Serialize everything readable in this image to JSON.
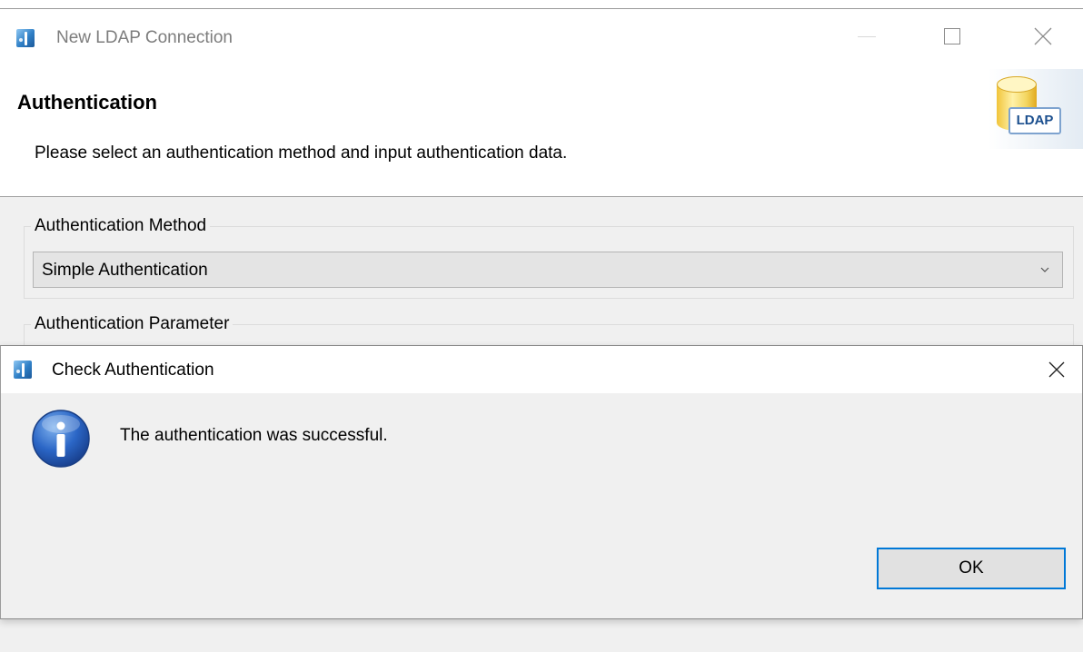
{
  "main_window": {
    "title": "New LDAP Connection",
    "app_icon": "eclipse-app-icon",
    "controls": {
      "minimize": "minimize-icon",
      "maximize": "maximize-icon",
      "close": "close-icon"
    }
  },
  "wizard": {
    "heading": "Authentication",
    "description": "Please select an authentication method and input authentication data.",
    "icon": "ldap-database-icon",
    "icon_label": "LDAP"
  },
  "auth_method": {
    "group_label": "Authentication Method",
    "selected": "Simple Authentication"
  },
  "auth_param": {
    "group_label": "Authentication Parameter"
  },
  "dialog": {
    "title": "Check Authentication",
    "icon": "info-icon",
    "message": "The authentication was successful.",
    "ok_label": "OK"
  },
  "colors": {
    "accent": "#0078d7",
    "dialog_bg": "#f0f0f0",
    "titlebar_bg": "#ffffff",
    "ldap_text": "#1b4f8e"
  }
}
